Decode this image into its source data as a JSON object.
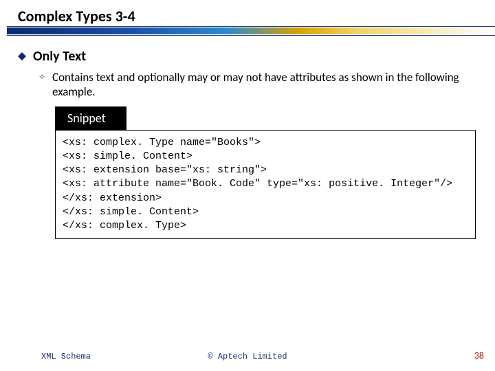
{
  "header": {
    "title": "Complex Types 3-4"
  },
  "content": {
    "heading": "Only Text",
    "paragraph": "Contains text and optionally may or may not have attributes as shown in the following example.",
    "snippet_label": "Snippet",
    "code": "<xs: complex. Type name=\"Books\">\n<xs: simple. Content>\n<xs: extension base=\"xs: string\">\n<xs: attribute name=\"Book. Code\" type=\"xs: positive. Integer\"/>\n</xs: extension>\n</xs: simple. Content>\n</xs: complex. Type>"
  },
  "footer": {
    "left": "XML Schema",
    "center": "© Aptech Limited",
    "page": "38"
  }
}
